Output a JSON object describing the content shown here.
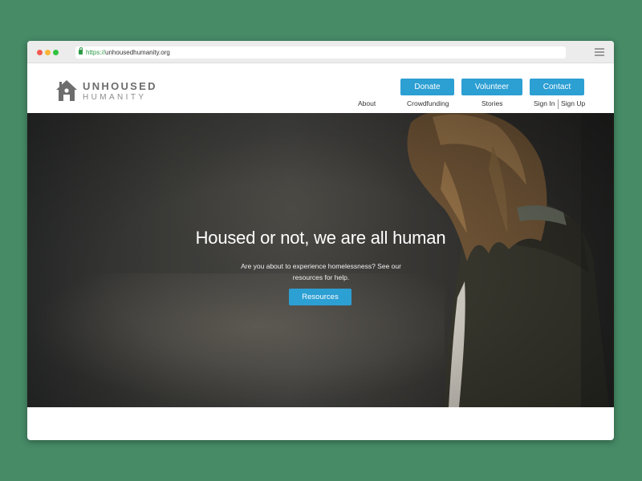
{
  "browser": {
    "url_scheme": "https://",
    "url_host": "unhousedhumanity.org"
  },
  "brand": {
    "name_line1": "UNHOUSED",
    "name_line2": "HUMANITY"
  },
  "header": {
    "buttons": [
      {
        "label": "Donate"
      },
      {
        "label": "Volunteer"
      },
      {
        "label": "Contact"
      }
    ],
    "nav": [
      {
        "label": "About"
      },
      {
        "label": "Crowdfunding"
      },
      {
        "label": "Stories"
      },
      {
        "label": "Sign In"
      },
      {
        "label": "Sign Up"
      }
    ]
  },
  "hero": {
    "title": "Housed or not, we are all human",
    "subtitle": "Are you about to experience homelessness? See our resources for help.",
    "button_label": "Resources"
  },
  "colors": {
    "background": "#468a66",
    "accent": "#2c9fd3",
    "logo_gray": "#6d6d6d"
  },
  "icons": [
    "house-logo-icon",
    "lock-icon",
    "menu-icon"
  ]
}
